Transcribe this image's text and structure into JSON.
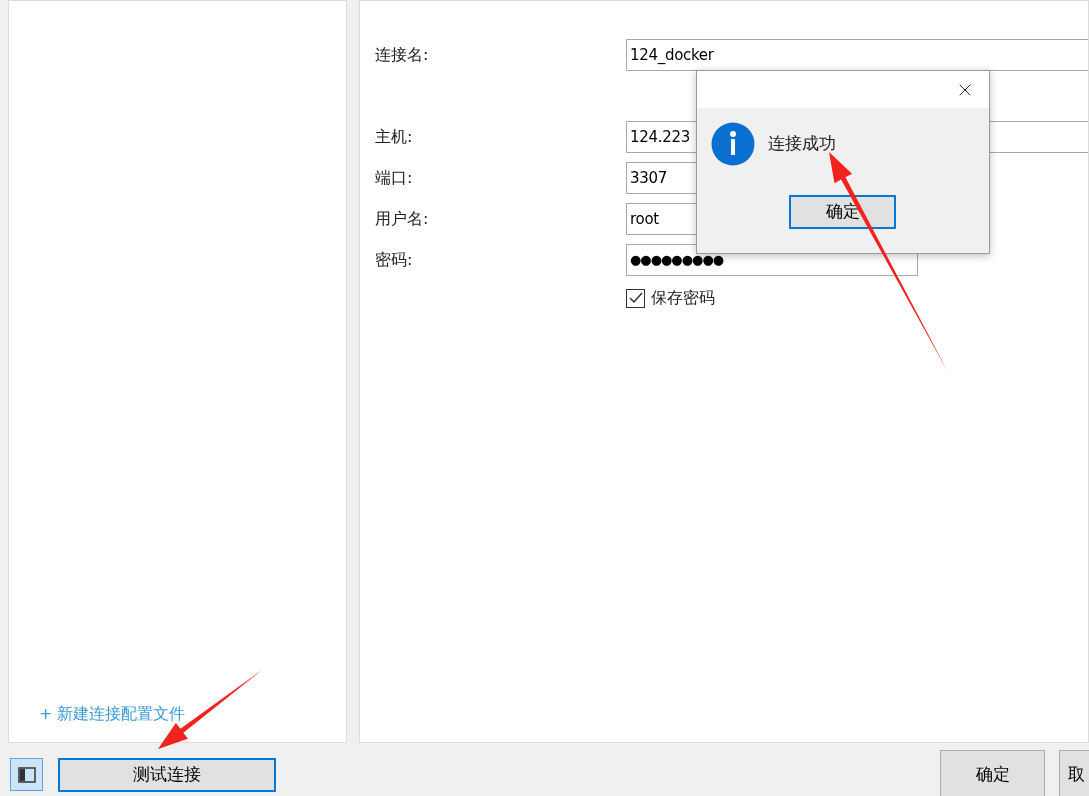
{
  "sidebar": {
    "new_profile_link": "+ 新建连接配置文件"
  },
  "form": {
    "fields": [
      {
        "label": "连接名:",
        "value": "124_docker",
        "kind": "text"
      },
      {
        "label": "主机:",
        "value": "124.223",
        "kind": "text"
      },
      {
        "label": "端口:",
        "value": "3307",
        "kind": "text"
      },
      {
        "label": "用户名:",
        "value": "root",
        "kind": "text"
      },
      {
        "label": "密码:",
        "value": "●●●●●●●●●",
        "kind": "password"
      }
    ],
    "save_password": {
      "label": "保存密码",
      "checked": true
    }
  },
  "dialog": {
    "message": "连接成功",
    "ok_button": "确定"
  },
  "footer": {
    "test_button": "测试连接",
    "ok_button": "确定",
    "cancel_button": "取"
  }
}
